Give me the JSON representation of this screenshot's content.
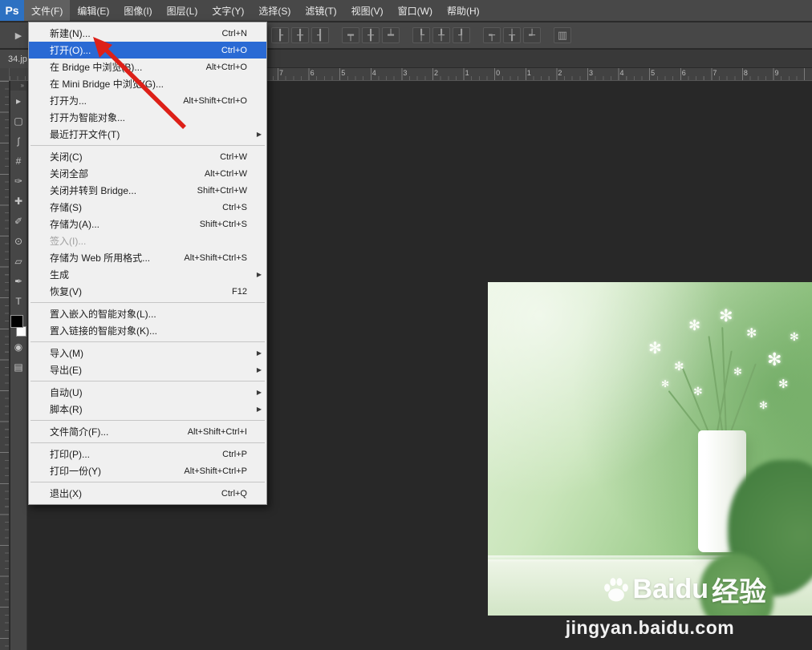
{
  "titlebar": {
    "logo": "Ps",
    "menus": [
      {
        "label": "文件(F)",
        "name": "menubar-file",
        "active": true
      },
      {
        "label": "编辑(E)",
        "name": "menubar-edit"
      },
      {
        "label": "图像(I)",
        "name": "menubar-image"
      },
      {
        "label": "图层(L)",
        "name": "menubar-layer"
      },
      {
        "label": "文字(Y)",
        "name": "menubar-type"
      },
      {
        "label": "选择(S)",
        "name": "menubar-select"
      },
      {
        "label": "滤镜(T)",
        "name": "menubar-filter"
      },
      {
        "label": "视图(V)",
        "name": "menubar-view"
      },
      {
        "label": "窗口(W)",
        "name": "menubar-window"
      },
      {
        "label": "帮助(H)",
        "name": "menubar-help"
      }
    ]
  },
  "options_bar": {
    "preset_glyph": "▶",
    "icons": [
      {
        "glyph": "┠",
        "name": "align-left-edges-icon"
      },
      {
        "glyph": "╂",
        "name": "align-horizontal-centers-icon"
      },
      {
        "glyph": "┨",
        "name": "align-right-edges-icon"
      },
      {
        "glyph": "┯",
        "name": "align-top-edges-icon"
      },
      {
        "glyph": "╂",
        "name": "align-vertical-centers-icon"
      },
      {
        "glyph": "┷",
        "name": "align-bottom-edges-icon"
      },
      {
        "glyph": "┞",
        "name": "distribute-left-edges-icon"
      },
      {
        "glyph": "╀",
        "name": "distribute-horizontal-centers-icon"
      },
      {
        "glyph": "┦",
        "name": "distribute-right-edges-icon"
      },
      {
        "glyph": "┭",
        "name": "distribute-top-edges-icon"
      },
      {
        "glyph": "╁",
        "name": "distribute-vertical-centers-icon"
      },
      {
        "glyph": "┵",
        "name": "distribute-bottom-edges-icon"
      },
      {
        "glyph": "▥",
        "name": "auto-align-layers-icon"
      }
    ]
  },
  "document_tab": {
    "label": "34.jp"
  },
  "ruler": {
    "numbers": [
      "7",
      "6",
      "5",
      "4",
      "3",
      "2",
      "1",
      "0",
      "1",
      "2",
      "3",
      "4",
      "5",
      "6",
      "7",
      "8",
      "9"
    ]
  },
  "toolbar": {
    "header_glyph": "»",
    "tools": [
      {
        "glyph": "▸",
        "name": "move-tool"
      },
      {
        "glyph": "▢",
        "name": "rectangular-marquee-tool"
      },
      {
        "glyph": "ʃ",
        "name": "lasso-tool"
      },
      {
        "glyph": "#",
        "name": "crop-tool"
      },
      {
        "glyph": "✑",
        "name": "eyedropper-tool"
      },
      {
        "glyph": "✚",
        "name": "spot-healing-brush-tool"
      },
      {
        "glyph": "✐",
        "name": "brush-tool"
      },
      {
        "glyph": "⊙",
        "name": "clone-stamp-tool"
      },
      {
        "glyph": "▱",
        "name": "eraser-tool"
      },
      {
        "glyph": "✒",
        "name": "pen-tool"
      },
      {
        "glyph": "T",
        "name": "horizontal-type-tool"
      }
    ],
    "extra_tools": [
      {
        "glyph": "◉",
        "name": "quick-mask-icon"
      },
      {
        "glyph": "▤",
        "name": "screen-mode-icon"
      }
    ]
  },
  "file_menu": {
    "items": [
      {
        "type": "item",
        "name": "menu-new",
        "label": "新建(N)...",
        "shortcut": "Ctrl+N"
      },
      {
        "type": "item",
        "name": "menu-open",
        "label": "打开(O)...",
        "shortcut": "Ctrl+O",
        "highlighted": true
      },
      {
        "type": "item",
        "name": "menu-browse-in-bridge",
        "label": "在 Bridge 中浏览(B)...",
        "shortcut": "Alt+Ctrl+O"
      },
      {
        "type": "item",
        "name": "menu-browse-in-mini-bridge",
        "label": "在 Mini Bridge 中浏览(G)..."
      },
      {
        "type": "item",
        "name": "menu-open-as",
        "label": "打开为...",
        "shortcut": "Alt+Shift+Ctrl+O"
      },
      {
        "type": "item",
        "name": "menu-open-as-smart-object",
        "label": "打开为智能对象..."
      },
      {
        "type": "item",
        "name": "menu-open-recent",
        "label": "最近打开文件(T)",
        "submenu": true
      },
      {
        "type": "separator"
      },
      {
        "type": "item",
        "name": "menu-close",
        "label": "关闭(C)",
        "shortcut": "Ctrl+W"
      },
      {
        "type": "item",
        "name": "menu-close-all",
        "label": "关闭全部",
        "shortcut": "Alt+Ctrl+W"
      },
      {
        "type": "item",
        "name": "menu-close-and-go-to-bridge",
        "label": "关闭并转到 Bridge...",
        "shortcut": "Shift+Ctrl+W"
      },
      {
        "type": "item",
        "name": "menu-save",
        "label": "存储(S)",
        "shortcut": "Ctrl+S"
      },
      {
        "type": "item",
        "name": "menu-save-as",
        "label": "存储为(A)...",
        "shortcut": "Shift+Ctrl+S"
      },
      {
        "type": "item",
        "name": "menu-check-in",
        "label": "签入(I)...",
        "disabled": true
      },
      {
        "type": "item",
        "name": "menu-save-for-web",
        "label": "存储为 Web 所用格式...",
        "shortcut": "Alt+Shift+Ctrl+S"
      },
      {
        "type": "item",
        "name": "menu-generate",
        "label": "生成",
        "submenu": true
      },
      {
        "type": "item",
        "name": "menu-revert",
        "label": "恢复(V)",
        "shortcut": "F12"
      },
      {
        "type": "separator"
      },
      {
        "type": "item",
        "name": "menu-place-embedded",
        "label": "置入嵌入的智能对象(L)..."
      },
      {
        "type": "item",
        "name": "menu-place-linked",
        "label": "置入链接的智能对象(K)..."
      },
      {
        "type": "separator"
      },
      {
        "type": "item",
        "name": "menu-import",
        "label": "导入(M)",
        "submenu": true
      },
      {
        "type": "item",
        "name": "menu-export",
        "label": "导出(E)",
        "submenu": true
      },
      {
        "type": "separator"
      },
      {
        "type": "item",
        "name": "menu-automate",
        "label": "自动(U)",
        "submenu": true
      },
      {
        "type": "item",
        "name": "menu-scripts",
        "label": "脚本(R)",
        "submenu": true
      },
      {
        "type": "separator"
      },
      {
        "type": "item",
        "name": "menu-file-info",
        "label": "文件简介(F)...",
        "shortcut": "Alt+Shift+Ctrl+I"
      },
      {
        "type": "separator"
      },
      {
        "type": "item",
        "name": "menu-print",
        "label": "打印(P)...",
        "shortcut": "Ctrl+P"
      },
      {
        "type": "item",
        "name": "menu-print-one-copy",
        "label": "打印一份(Y)",
        "shortcut": "Alt+Shift+Ctrl+P"
      },
      {
        "type": "separator"
      },
      {
        "type": "item",
        "name": "menu-exit",
        "label": "退出(X)",
        "shortcut": "Ctrl+Q"
      }
    ]
  },
  "photo": {
    "watermark": {
      "brand": "Baidu",
      "suffix": "经验",
      "url": "jingyan.baidu.com"
    }
  },
  "colors": {
    "chrome_gray": "#474747",
    "canvas_gray": "#282828",
    "menu_background": "#f0f0f0",
    "menu_highlight_blue": "#2a6ad4",
    "annotation_red": "#dd2018",
    "logo_blue": "#2d71c2"
  }
}
